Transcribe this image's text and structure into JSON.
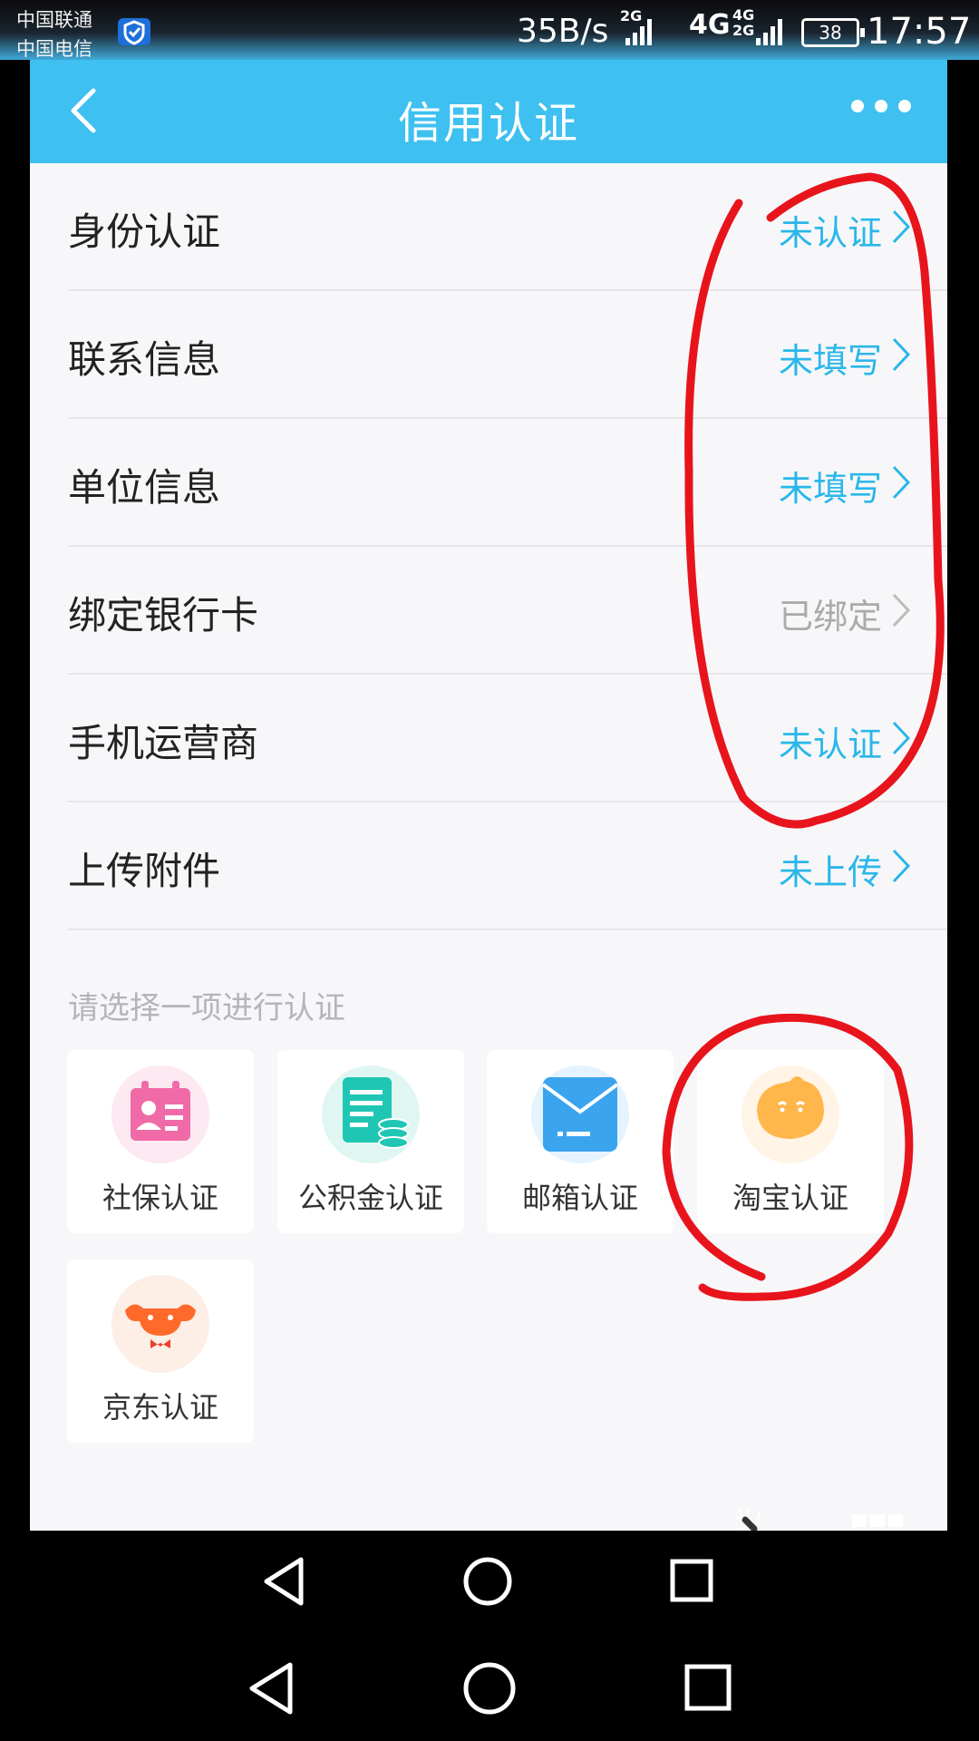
{
  "status_bar": {
    "carrier_1": "中国联通",
    "carrier_2": "中国电信",
    "net_speed": "35B/s",
    "tag_2g": "2G",
    "tag_4g": "4G",
    "tag_4g_small": "4G",
    "tag_2g_small": "2G",
    "battery": "38",
    "time": "17:57"
  },
  "header": {
    "title": "信用认证",
    "back_icon": "chevron-left-icon",
    "more_icon": "more-dots-icon"
  },
  "rows": [
    {
      "label": "身份认证",
      "status": "未认证",
      "state": "pending"
    },
    {
      "label": "联系信息",
      "status": "未填写",
      "state": "pending"
    },
    {
      "label": "单位信息",
      "status": "未填写",
      "state": "pending"
    },
    {
      "label": "绑定银行卡",
      "status": "已绑定",
      "state": "done"
    },
    {
      "label": "手机运营商",
      "status": "未认证",
      "state": "pending"
    },
    {
      "label": "上传附件",
      "status": "未上传",
      "state": "pending"
    }
  ],
  "section_hint": "请选择一项进行认证",
  "options": [
    {
      "label": "社保认证",
      "icon": "id-card-icon"
    },
    {
      "label": "公积金认证",
      "icon": "document-coins-icon"
    },
    {
      "label": "邮箱认证",
      "icon": "envelope-icon"
    },
    {
      "label": "淘宝认证",
      "icon": "taobao-face-icon"
    },
    {
      "label": "京东认证",
      "icon": "jd-dog-icon"
    }
  ],
  "colors": {
    "accent": "#3ec0f0",
    "status_pending": "#2ab7ea",
    "status_done": "#aaaaaa",
    "annotation": "#e8141c"
  }
}
